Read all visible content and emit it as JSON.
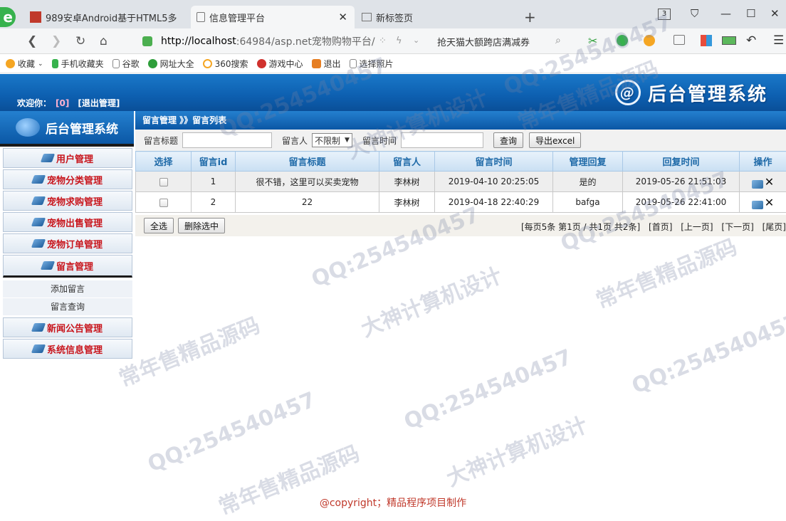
{
  "browser": {
    "tabs": [
      {
        "title": "989安卓Android基于HTML5多",
        "active": false
      },
      {
        "title": "信息管理平台",
        "active": true
      },
      {
        "title": "新标签页",
        "active": false
      }
    ],
    "tab_count": "3",
    "url_host": "http://localhost",
    "url_rest": ":64984/asp.net宠物购物平台/",
    "search_text": "抢天猫大额跨店满减券",
    "bookmarks": [
      "收藏",
      "手机收藏夹",
      "谷歌",
      "网址大全",
      "360搜索",
      "游戏中心",
      "退出",
      "选择照片"
    ]
  },
  "header": {
    "welcome_label": "欢迎你：",
    "username": "[0]",
    "logout": "[退出管理]",
    "system_title": "后台管理系统",
    "emblem": "@"
  },
  "sidebar": {
    "brand": "后台管理系统",
    "menus": [
      {
        "label": "用户管理"
      },
      {
        "label": "宠物分类管理"
      },
      {
        "label": "宠物求购管理"
      },
      {
        "label": "宠物出售管理"
      },
      {
        "label": "宠物订单管理"
      },
      {
        "label": "留言管理"
      }
    ],
    "submenu": [
      "添加留言",
      "留言查询"
    ],
    "menus_after": [
      {
        "label": "新闻公告管理"
      },
      {
        "label": "系统信息管理"
      }
    ]
  },
  "breadcrumb": "留言管理 》》留言列表",
  "filters": {
    "title_label": "留言标题",
    "title_value": "",
    "author_label": "留言人",
    "author_selected": "不限制",
    "time_label": "留言时间",
    "time_value": "",
    "query_button": "查询",
    "export_button": "导出excel"
  },
  "table": {
    "columns": [
      "选择",
      "留言id",
      "留言标题",
      "留言人",
      "留言时间",
      "管理回复",
      "回复时间",
      "操作"
    ],
    "rows": [
      {
        "id": "1",
        "title": "很不错，这里可以买卖宠物",
        "author": "李林树",
        "time": "2019-04-10 20:25:05",
        "reply": "是的",
        "reply_time": "2019-05-26 21:51:03"
      },
      {
        "id": "2",
        "title": "22",
        "author": "李林树",
        "time": "2019-04-18 22:40:29",
        "reply": "bafga",
        "reply_time": "2019-05-26 22:41:00"
      }
    ]
  },
  "footer_actions": {
    "select_all": "全选",
    "delete_selected": "删除选中"
  },
  "pager": {
    "summary": "[每页5条 第1页 / 共1页 共2条]",
    "first": "[首页]",
    "prev": "[上一页]",
    "next": "[下一页]",
    "last": "[尾页]"
  },
  "copyright": "@copyright；精品程序项目制作",
  "watermarks": [
    "QQ:254540457",
    "常年售精品源码",
    "大神计算机设计"
  ]
}
